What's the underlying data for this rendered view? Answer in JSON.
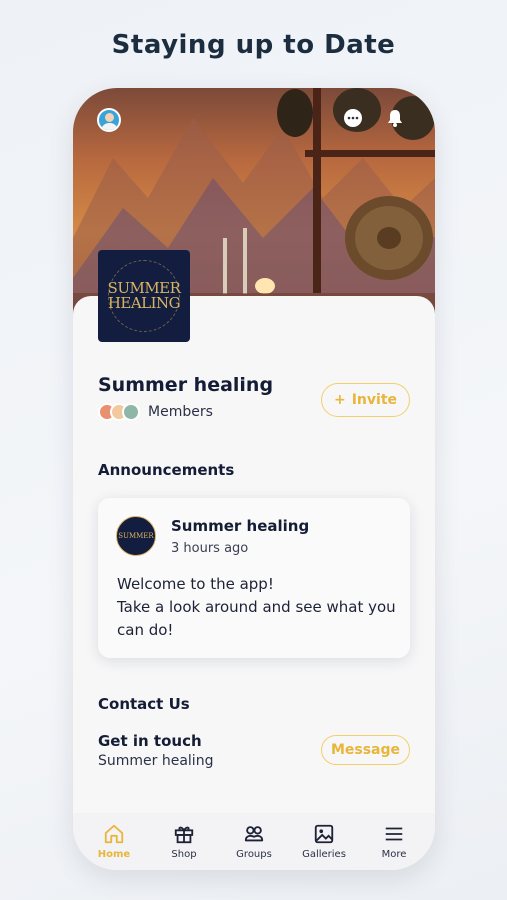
{
  "headline": "Staying up to Date",
  "group": {
    "logo_text_line1": "SUMMER",
    "logo_text_line2": "HEALING",
    "title": "Summer healing",
    "members_label": "Members",
    "invite_label": "Invite"
  },
  "announcements": {
    "section_title": "Announcements",
    "post": {
      "author": "Summer healing",
      "time": "3 hours ago",
      "line1": "Welcome to the app!",
      "line2": "Take a look around and see what you",
      "line3": "can do!"
    }
  },
  "contact": {
    "section_title": "Contact Us",
    "subtitle": "Get in touch",
    "name": "Summer healing",
    "message_label": "Message"
  },
  "tabs": [
    {
      "label": "Home",
      "icon": "home-icon",
      "active": true
    },
    {
      "label": "Shop",
      "icon": "gift-icon",
      "active": false
    },
    {
      "label": "Groups",
      "icon": "groups-icon",
      "active": false
    },
    {
      "label": "Galleries",
      "icon": "image-icon",
      "active": false
    },
    {
      "label": "More",
      "icon": "menu-icon",
      "active": false
    }
  ],
  "colors": {
    "accent": "#e9b53a",
    "accent_border": "#f3cf6c",
    "navy": "#131d3f"
  }
}
